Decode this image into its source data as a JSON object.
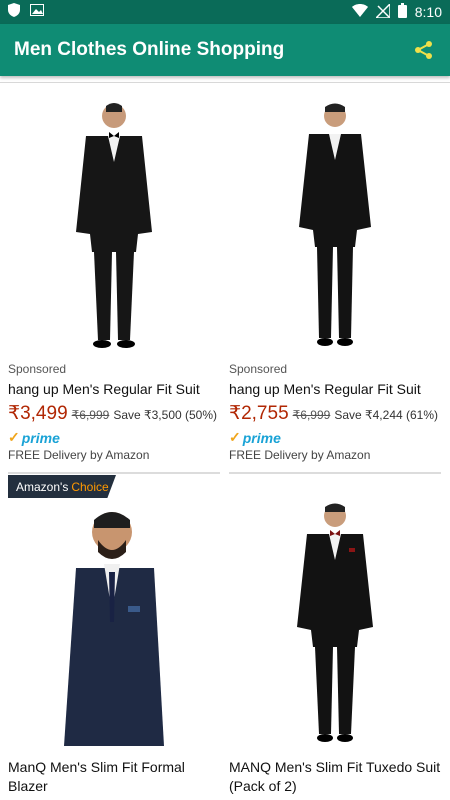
{
  "status_bar": {
    "time": "8:10"
  },
  "app_bar": {
    "title": "Men Clothes Online Shopping"
  },
  "products_row1": [
    {
      "sponsored": "Sponsored",
      "title": "hang up Men's Regular Fit Suit",
      "price": "₹3,499",
      "mrp": "₹6,999",
      "save": "Save ₹3,500 (50%)",
      "prime": "prime",
      "delivery": "FREE Delivery by Amazon"
    },
    {
      "sponsored": "Sponsored",
      "title": "hang up Men's Regular Fit Suit",
      "price": "₹2,755",
      "mrp": "₹6,999",
      "save": "Save ₹4,244 (61%)",
      "prime": "prime",
      "delivery": "FREE Delivery by Amazon"
    }
  ],
  "badge": {
    "brand": "Amazon's",
    "choice": "Choice"
  },
  "products_row2": [
    {
      "title": "ManQ Men's Slim Fit Formal Blazer"
    },
    {
      "title": "MANQ Men's Slim Fit Tuxedo Suit (Pack of 2)"
    }
  ],
  "colors": {
    "appbar": "#0f8c74",
    "statusbar": "#0a6b58",
    "price": "#b12704",
    "accent": "#ff9900"
  }
}
